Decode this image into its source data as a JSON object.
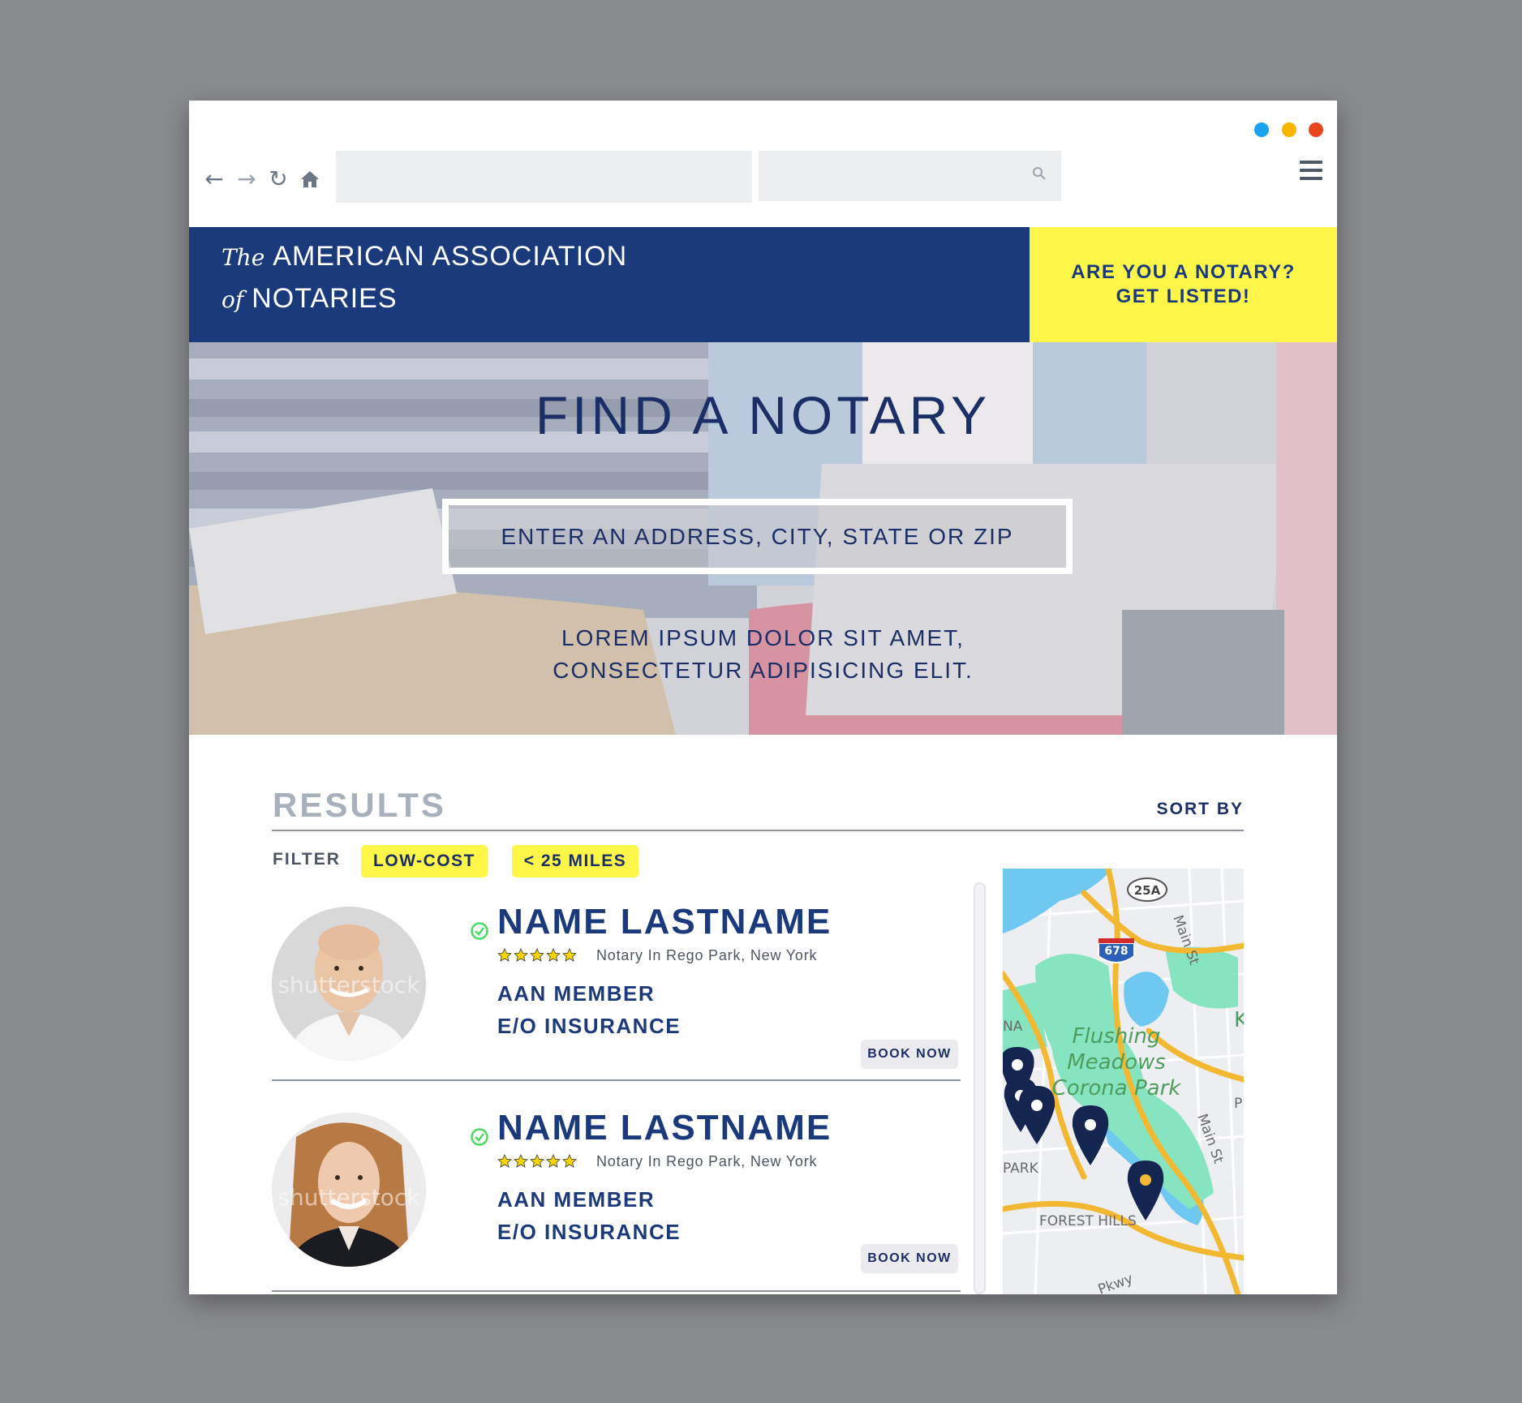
{
  "window_controls": {
    "colors": [
      "#1aa3f0",
      "#f7b500",
      "#e8461c"
    ]
  },
  "browser": {
    "nav_icons": [
      "back-arrow-icon",
      "forward-arrow-icon",
      "reload-icon",
      "home-icon"
    ],
    "url_value": "",
    "search_value": "",
    "search_icon": "magnifier-icon",
    "menu_icon": "hamburger-menu-icon"
  },
  "header": {
    "logo_the": "The",
    "logo_line1": "AMERICAN ASSOCIATION",
    "logo_of": "of",
    "logo_line2": "NOTARIES",
    "cta_line1": "ARE YOU A NOTARY?",
    "cta_line2": "GET LISTED!"
  },
  "hero": {
    "title": "FIND A NOTARY",
    "search_placeholder": "ENTER AN ADDRESS, CITY, STATE OR ZIP",
    "sub_line1": "LOREM IPSUM DOLOR SIT AMET,",
    "sub_line2": "CONSECTETUR ADIPISICING ELIT."
  },
  "results": {
    "title": "RESULTS",
    "sort_label": "SORT BY",
    "filter_label": "FILTER",
    "filters": [
      "LOW-COST",
      "< 25 MILES"
    ],
    "items": [
      {
        "name": "NAME LASTNAME",
        "rating": 5,
        "location": "Notary In Rego Park, New York",
        "tag1": "AAN MEMBER",
        "tag2": "E/O INSURANCE",
        "book_label": "BOOK NOW",
        "watermark": "shutterstock"
      },
      {
        "name": "NAME LASTNAME",
        "rating": 5,
        "location": "Notary In Rego Park, New York",
        "tag1": "AAN MEMBER",
        "tag2": "E/O INSURANCE",
        "book_label": "BOOK NOW",
        "watermark": "shutterstock"
      }
    ]
  },
  "map": {
    "labels": {
      "park_line1": "Flushing",
      "park_line2": "Meadows",
      "park_line3": "Corona Park",
      "forest_hills": "FOREST HILLS",
      "park_edge": "PARK",
      "na_edge": "NA",
      "k_edge": "K",
      "p_edge": "P",
      "main_st_1": "Main St",
      "main_st_2": "Main St",
      "pkwy": "Pkwy",
      "shield_25a": "25A",
      "shield_678": "678"
    },
    "pin_count": 5,
    "colors": {
      "water": "#6fc8ef",
      "park": "#87e4c0",
      "highway": "#f3b832",
      "pin": "#14254f"
    }
  },
  "colors": {
    "brand_navy": "#1b3a7b",
    "accent_yellow": "#fff64a",
    "verified_green": "#4cd964"
  }
}
